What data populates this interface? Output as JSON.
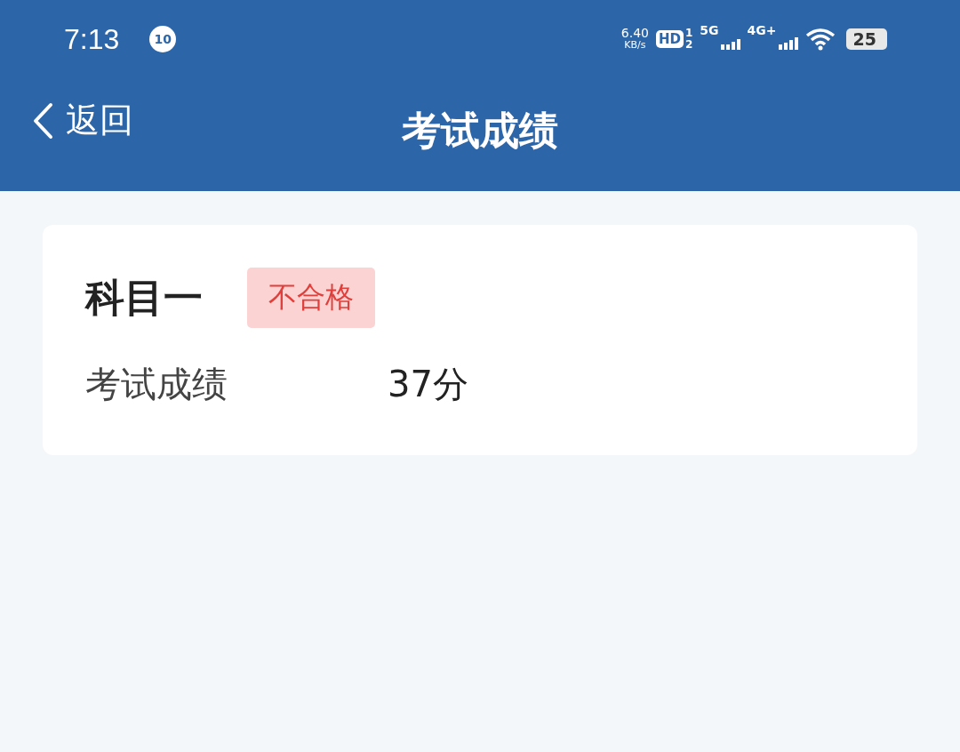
{
  "status_bar": {
    "time": "7:13",
    "notification_badge": "10",
    "net_speed": "6.40",
    "net_speed_unit": "KB/s",
    "hd": "HD",
    "sim_labels": [
      "1",
      "2"
    ],
    "network_5g": "5G",
    "network_4g": "4G+",
    "battery": "25"
  },
  "nav": {
    "back": "返回",
    "title": "考试成绩"
  },
  "results": [
    {
      "subject": "科目一",
      "status": "不合格",
      "passed": false,
      "score_label": "考试成绩",
      "score": "37分"
    }
  ]
}
